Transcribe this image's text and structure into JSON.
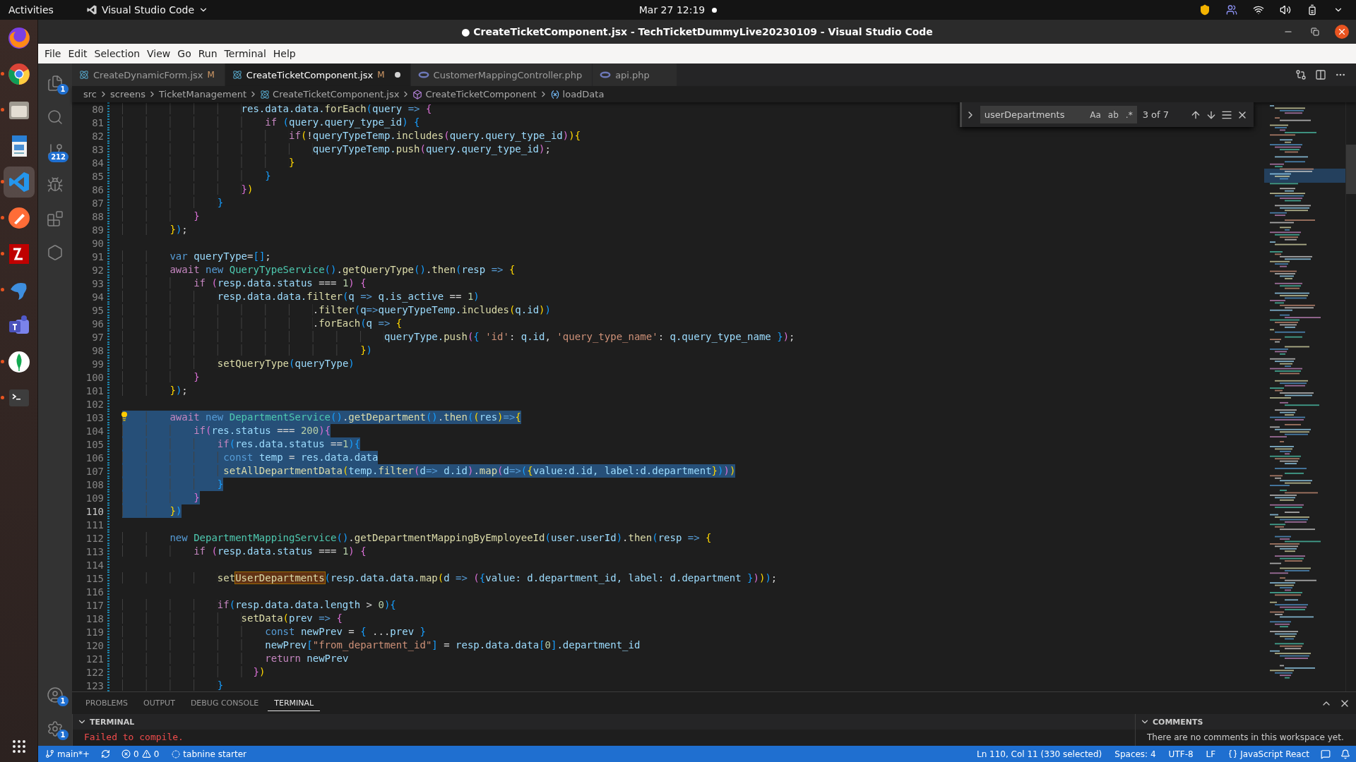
{
  "topbar": {
    "activities": "Activities",
    "app": "Visual Studio Code",
    "clock": "Mar 27  12:19"
  },
  "dock": [
    {
      "kind": "firefox",
      "running": false,
      "selected": false
    },
    {
      "kind": "chrome",
      "running": true,
      "selected": false
    },
    {
      "kind": "files",
      "running": true,
      "selected": false
    },
    {
      "kind": "writer",
      "running": false,
      "selected": false
    },
    {
      "kind": "vscode",
      "running": true,
      "selected": true
    },
    {
      "kind": "postman",
      "running": true,
      "selected": false
    },
    {
      "kind": "filezilla",
      "running": true,
      "selected": false
    },
    {
      "kind": "dolphin",
      "running": true,
      "selected": false
    },
    {
      "kind": "teams",
      "running": false,
      "selected": false
    },
    {
      "kind": "mongodb",
      "running": true,
      "selected": false
    },
    {
      "kind": "terminal",
      "running": true,
      "selected": false
    }
  ],
  "window": {
    "title": "● CreateTicketComponent.jsx - TechTicketDummyLive20230109 - Visual Studio Code"
  },
  "menu": [
    "File",
    "Edit",
    "Selection",
    "View",
    "Go",
    "Run",
    "Terminal",
    "Help"
  ],
  "activity_bar": [
    {
      "kind": "explorer",
      "badge": "1"
    },
    {
      "kind": "search"
    },
    {
      "kind": "scm",
      "badge": "212"
    },
    {
      "kind": "debug"
    },
    {
      "kind": "extensions"
    },
    {
      "kind": "remote"
    }
  ],
  "activity_bar_bottom": [
    {
      "kind": "accounts",
      "badge": "1"
    },
    {
      "kind": "settings",
      "badge": "1"
    }
  ],
  "tabs": [
    {
      "label": "CreateDynamicForm.jsx",
      "kind": "react",
      "status": "M",
      "dirty": false,
      "selected": false
    },
    {
      "label": "CreateTicketComponent.jsx",
      "kind": "react",
      "status": "M",
      "dirty": true,
      "selected": true
    },
    {
      "label": "CustomerMappingController.php",
      "kind": "php",
      "dirty": false,
      "selected": false
    },
    {
      "label": "api.php",
      "kind": "php",
      "dirty": false,
      "selected": false
    }
  ],
  "breadcrumbs": [
    {
      "label": "src",
      "kind": "folder"
    },
    {
      "label": "screens",
      "kind": "folder"
    },
    {
      "label": "TicketManagement",
      "kind": "folder"
    },
    {
      "label": "CreateTicketComponent.jsx",
      "kind": "react"
    },
    {
      "label": "CreateTicketComponent",
      "kind": "component"
    },
    {
      "label": "loadData",
      "kind": "variable"
    }
  ],
  "find": {
    "value": "userDepartments",
    "options": [
      "Aa",
      "ab",
      ".*"
    ],
    "count": "3 of 7"
  },
  "code": [
    {
      "n": "80",
      "selected": false,
      "active": false,
      "tokens": [
        {
          "kind": "v",
          "text": "                    res.data.data."
        },
        {
          "kind": "f",
          "text": "forEach"
        },
        {
          "kind": "b3",
          "text": "("
        },
        {
          "kind": "v",
          "text": "query"
        },
        {
          "kind": "k",
          "text": " => "
        },
        {
          "kind": "b2",
          "text": "{"
        }
      ]
    },
    {
      "n": "81",
      "selected": false,
      "active": false,
      "tokens": [
        {
          "kind": "c",
          "text": "                        if "
        },
        {
          "kind": "b3",
          "text": "("
        },
        {
          "kind": "v",
          "text": "query.query_type_id"
        },
        {
          "kind": "b3",
          "text": ") {"
        }
      ]
    },
    {
      "n": "82",
      "selected": false,
      "active": false,
      "tokens": [
        {
          "kind": "c",
          "text": "                            if"
        },
        {
          "kind": "b1",
          "text": "("
        },
        {
          "kind": "p",
          "text": "!"
        },
        {
          "kind": "v",
          "text": "queryTypeTemp."
        },
        {
          "kind": "f",
          "text": "includes"
        },
        {
          "kind": "b2",
          "text": "("
        },
        {
          "kind": "v",
          "text": "query.query_type_id"
        },
        {
          "kind": "b2",
          "text": ")"
        },
        {
          "kind": "b1",
          "text": "){"
        }
      ]
    },
    {
      "n": "83",
      "selected": false,
      "active": false,
      "tokens": [
        {
          "kind": "v",
          "text": "                                queryTypeTemp."
        },
        {
          "kind": "f",
          "text": "push"
        },
        {
          "kind": "b2",
          "text": "("
        },
        {
          "kind": "v",
          "text": "query.query_type_id"
        },
        {
          "kind": "b2",
          "text": ")"
        },
        {
          "kind": "p",
          "text": ";"
        }
      ]
    },
    {
      "n": "84",
      "selected": false,
      "active": false,
      "tokens": [
        {
          "kind": "b1",
          "text": "                            }"
        }
      ]
    },
    {
      "n": "85",
      "selected": false,
      "active": false,
      "tokens": [
        {
          "kind": "b3",
          "text": "                        }"
        }
      ]
    },
    {
      "n": "86",
      "selected": false,
      "active": false,
      "tokens": [
        {
          "kind": "b2",
          "text": "                    }"
        },
        {
          "kind": "b1",
          "text": ")"
        }
      ]
    },
    {
      "n": "87",
      "selected": false,
      "active": false,
      "tokens": [
        {
          "kind": "b3",
          "text": "                }"
        }
      ]
    },
    {
      "n": "88",
      "selected": false,
      "active": false,
      "tokens": [
        {
          "kind": "b2",
          "text": "            }"
        }
      ]
    },
    {
      "n": "89",
      "selected": false,
      "active": false,
      "tokens": [
        {
          "kind": "b1",
          "text": "        }"
        },
        {
          "kind": "b3",
          "text": ")"
        },
        {
          "kind": "p",
          "text": ";"
        }
      ]
    },
    {
      "n": "90",
      "selected": false,
      "active": false
    },
    {
      "n": "91",
      "selected": false,
      "active": false,
      "tokens": [
        {
          "kind": "k",
          "text": "        var "
        },
        {
          "kind": "v",
          "text": "queryType"
        },
        {
          "kind": "p",
          "text": "="
        },
        {
          "kind": "b3",
          "text": "[]"
        },
        {
          "kind": "p",
          "text": ";"
        }
      ]
    },
    {
      "n": "92",
      "selected": false,
      "active": false,
      "tokens": [
        {
          "kind": "c",
          "text": "        await "
        },
        {
          "kind": "k",
          "text": "new "
        },
        {
          "kind": "t",
          "text": "QueryTypeService"
        },
        {
          "kind": "b3",
          "text": "()"
        },
        {
          "kind": "p",
          "text": "."
        },
        {
          "kind": "f",
          "text": "getQueryType"
        },
        {
          "kind": "b3",
          "text": "()"
        },
        {
          "kind": "p",
          "text": "."
        },
        {
          "kind": "f",
          "text": "then"
        },
        {
          "kind": "b3",
          "text": "("
        },
        {
          "kind": "v",
          "text": "resp"
        },
        {
          "kind": "k",
          "text": " => "
        },
        {
          "kind": "b1",
          "text": "{"
        }
      ]
    },
    {
      "n": "93",
      "selected": false,
      "active": false,
      "tokens": [
        {
          "kind": "c",
          "text": "            if "
        },
        {
          "kind": "b2",
          "text": "("
        },
        {
          "kind": "v",
          "text": "resp.data.status"
        },
        {
          "kind": "p",
          "text": " === "
        },
        {
          "kind": "n",
          "text": "1"
        },
        {
          "kind": "b2",
          "text": ") {"
        }
      ]
    },
    {
      "n": "94",
      "selected": false,
      "active": false,
      "tokens": [
        {
          "kind": "v",
          "text": "                resp.data.data."
        },
        {
          "kind": "f",
          "text": "filter"
        },
        {
          "kind": "b3",
          "text": "("
        },
        {
          "kind": "v",
          "text": "q"
        },
        {
          "kind": "k",
          "text": " => "
        },
        {
          "kind": "v",
          "text": "q.is_active"
        },
        {
          "kind": "p",
          "text": " == "
        },
        {
          "kind": "n",
          "text": "1"
        },
        {
          "kind": "b3",
          "text": ")"
        }
      ]
    },
    {
      "n": "95",
      "selected": false,
      "active": false,
      "tokens": [
        {
          "kind": "p",
          "text": "                                ."
        },
        {
          "kind": "f",
          "text": "filter"
        },
        {
          "kind": "b3",
          "text": "("
        },
        {
          "kind": "v",
          "text": "q"
        },
        {
          "kind": "k",
          "text": "=>"
        },
        {
          "kind": "v",
          "text": "queryTypeTemp."
        },
        {
          "kind": "f",
          "text": "includes"
        },
        {
          "kind": "b1",
          "text": "("
        },
        {
          "kind": "v",
          "text": "q.id"
        },
        {
          "kind": "b1",
          "text": ")"
        },
        {
          "kind": "b3",
          "text": ")"
        }
      ]
    },
    {
      "n": "96",
      "selected": false,
      "active": false,
      "tokens": [
        {
          "kind": "p",
          "text": "                                ."
        },
        {
          "kind": "f",
          "text": "forEach"
        },
        {
          "kind": "b3",
          "text": "("
        },
        {
          "kind": "v",
          "text": "q"
        },
        {
          "kind": "k",
          "text": " => "
        },
        {
          "kind": "b1",
          "text": "{"
        }
      ]
    },
    {
      "n": "97",
      "selected": false,
      "active": false,
      "tokens": [
        {
          "kind": "v",
          "text": "                                            queryType."
        },
        {
          "kind": "f",
          "text": "push"
        },
        {
          "kind": "b2",
          "text": "("
        },
        {
          "kind": "b3",
          "text": "{ "
        },
        {
          "kind": "s",
          "text": "'id'"
        },
        {
          "kind": "p",
          "text": ": "
        },
        {
          "kind": "v",
          "text": "q.id"
        },
        {
          "kind": "p",
          "text": ", "
        },
        {
          "kind": "s",
          "text": "'query_type_name'"
        },
        {
          "kind": "p",
          "text": ": "
        },
        {
          "kind": "v",
          "text": "q.query_type_name "
        },
        {
          "kind": "b3",
          "text": "}"
        },
        {
          "kind": "b2",
          "text": ")"
        },
        {
          "kind": "p",
          "text": ";"
        }
      ]
    },
    {
      "n": "98",
      "selected": false,
      "active": false,
      "tokens": [
        {
          "kind": "b1",
          "text": "                                        }"
        },
        {
          "kind": "b3",
          "text": ")"
        }
      ]
    },
    {
      "n": "99",
      "selected": false,
      "active": false,
      "tokens": [
        {
          "kind": "f",
          "text": "                setQueryType"
        },
        {
          "kind": "b3",
          "text": "("
        },
        {
          "kind": "v",
          "text": "queryType"
        },
        {
          "kind": "b3",
          "text": ")"
        }
      ]
    },
    {
      "n": "100",
      "selected": false,
      "active": false,
      "tokens": [
        {
          "kind": "b2",
          "text": "            }"
        }
      ]
    },
    {
      "n": "101",
      "selected": false,
      "active": false,
      "tokens": [
        {
          "kind": "b1",
          "text": "        }"
        },
        {
          "kind": "b3",
          "text": ")"
        },
        {
          "kind": "p",
          "text": ";"
        }
      ]
    },
    {
      "n": "102",
      "selected": false,
      "active": false
    },
    {
      "n": "103",
      "selected": true,
      "active": false,
      "lightbulb": true,
      "tokens": [
        {
          "kind": "c",
          "text": "        await "
        },
        {
          "kind": "k",
          "text": "new "
        },
        {
          "kind": "t",
          "text": "DepartmentService"
        },
        {
          "kind": "b3",
          "text": "()"
        },
        {
          "kind": "p",
          "text": "."
        },
        {
          "kind": "f",
          "text": "getDepartment"
        },
        {
          "kind": "b3",
          "text": "()"
        },
        {
          "kind": "p",
          "text": "."
        },
        {
          "kind": "f",
          "text": "then"
        },
        {
          "kind": "b3",
          "text": "("
        },
        {
          "kind": "b1",
          "text": "("
        },
        {
          "kind": "v",
          "text": "res"
        },
        {
          "kind": "b1",
          "text": ")"
        },
        {
          "kind": "k",
          "text": "=>"
        },
        {
          "kind": "b1",
          "text": "{"
        }
      ]
    },
    {
      "n": "104",
      "selected": true,
      "active": false,
      "tokens": [
        {
          "kind": "c",
          "text": "            if"
        },
        {
          "kind": "b2",
          "text": "("
        },
        {
          "kind": "v",
          "text": "res.status"
        },
        {
          "kind": "p",
          "text": " === "
        },
        {
          "kind": "n",
          "text": "200"
        },
        {
          "kind": "b2",
          "text": "){"
        }
      ]
    },
    {
      "n": "105",
      "selected": true,
      "active": false,
      "tokens": [
        {
          "kind": "c",
          "text": "                if"
        },
        {
          "kind": "b3",
          "text": "("
        },
        {
          "kind": "v",
          "text": "res.data.status"
        },
        {
          "kind": "p",
          "text": " =="
        },
        {
          "kind": "n",
          "text": "1"
        },
        {
          "kind": "b3",
          "text": "){"
        }
      ]
    },
    {
      "n": "106",
      "selected": true,
      "active": false,
      "tokens": [
        {
          "kind": "k",
          "text": "                 const "
        },
        {
          "kind": "v",
          "text": "temp"
        },
        {
          "kind": "p",
          "text": " = "
        },
        {
          "kind": "v",
          "text": "res.data.data"
        }
      ]
    },
    {
      "n": "107",
      "selected": true,
      "active": false,
      "tokens": [
        {
          "kind": "f",
          "text": "                 setAllDepartmentData"
        },
        {
          "kind": "b1",
          "text": "("
        },
        {
          "kind": "v",
          "text": "temp."
        },
        {
          "kind": "f",
          "text": "filter"
        },
        {
          "kind": "b2",
          "text": "("
        },
        {
          "kind": "v",
          "text": "d"
        },
        {
          "kind": "k",
          "text": "=> "
        },
        {
          "kind": "v",
          "text": "d.id"
        },
        {
          "kind": "b2",
          "text": ")"
        },
        {
          "kind": "p",
          "text": "."
        },
        {
          "kind": "f",
          "text": "map"
        },
        {
          "kind": "b2",
          "text": "("
        },
        {
          "kind": "v",
          "text": "d"
        },
        {
          "kind": "k",
          "text": "=>"
        },
        {
          "kind": "b3",
          "text": "("
        },
        {
          "kind": "b1",
          "text": "{"
        },
        {
          "kind": "v",
          "text": "value:d.id, label:d.department"
        },
        {
          "kind": "b1",
          "text": "}"
        },
        {
          "kind": "b3",
          "text": ")"
        },
        {
          "kind": "b2",
          "text": ")"
        },
        {
          "kind": "b1",
          "text": ")"
        }
      ]
    },
    {
      "n": "108",
      "selected": true,
      "active": false,
      "tokens": [
        {
          "kind": "b3",
          "text": "                }"
        }
      ]
    },
    {
      "n": "109",
      "selected": true,
      "active": false,
      "tokens": [
        {
          "kind": "b2",
          "text": "            }"
        }
      ]
    },
    {
      "n": "110",
      "selected": true,
      "active": true,
      "tokens": [
        {
          "kind": "b1",
          "text": "        }"
        },
        {
          "kind": "b3",
          "text": ")"
        }
      ]
    },
    {
      "n": "111",
      "selected": false,
      "active": false
    },
    {
      "n": "112",
      "selected": false,
      "active": false,
      "tokens": [
        {
          "kind": "k",
          "text": "        new "
        },
        {
          "kind": "t",
          "text": "DepartmentMappingService"
        },
        {
          "kind": "b3",
          "text": "()"
        },
        {
          "kind": "p",
          "text": "."
        },
        {
          "kind": "f",
          "text": "getDepartmentMappingByEmployeeId"
        },
        {
          "kind": "b3",
          "text": "("
        },
        {
          "kind": "v",
          "text": "user.userId"
        },
        {
          "kind": "b3",
          "text": ")"
        },
        {
          "kind": "p",
          "text": "."
        },
        {
          "kind": "f",
          "text": "then"
        },
        {
          "kind": "b3",
          "text": "("
        },
        {
          "kind": "v",
          "text": "resp"
        },
        {
          "kind": "k",
          "text": " => "
        },
        {
          "kind": "b1",
          "text": "{"
        }
      ]
    },
    {
      "n": "113",
      "selected": false,
      "active": false,
      "tokens": [
        {
          "kind": "c",
          "text": "            if "
        },
        {
          "kind": "b2",
          "text": "("
        },
        {
          "kind": "v",
          "text": "resp.data.status"
        },
        {
          "kind": "p",
          "text": " === "
        },
        {
          "kind": "n",
          "text": "1"
        },
        {
          "kind": "b2",
          "text": ") {"
        }
      ]
    },
    {
      "n": "114",
      "selected": false,
      "active": false
    },
    {
      "n": "115",
      "selected": false,
      "active": false,
      "tokens": [
        {
          "kind": "f",
          "text": "                set"
        },
        {
          "kind": "m",
          "text": "UserDepartments"
        },
        {
          "kind": "b3",
          "text": "("
        },
        {
          "kind": "v",
          "text": "resp.data.data."
        },
        {
          "kind": "f",
          "text": "map"
        },
        {
          "kind": "b1",
          "text": "("
        },
        {
          "kind": "v",
          "text": "d"
        },
        {
          "kind": "k",
          "text": " => "
        },
        {
          "kind": "b2",
          "text": "("
        },
        {
          "kind": "b3",
          "text": "{"
        },
        {
          "kind": "v",
          "text": "value: d.department_id, label: d.department "
        },
        {
          "kind": "b3",
          "text": "}"
        },
        {
          "kind": "b2",
          "text": ")"
        },
        {
          "kind": "b1",
          "text": ")"
        },
        {
          "kind": "b3",
          "text": ")"
        },
        {
          "kind": "p",
          "text": ";"
        }
      ]
    },
    {
      "n": "116",
      "selected": false,
      "active": false
    },
    {
      "n": "117",
      "selected": false,
      "active": false,
      "tokens": [
        {
          "kind": "c",
          "text": "                if"
        },
        {
          "kind": "b3",
          "text": "("
        },
        {
          "kind": "v",
          "text": "resp.data.data.length"
        },
        {
          "kind": "p",
          "text": " > "
        },
        {
          "kind": "n",
          "text": "0"
        },
        {
          "kind": "b3",
          "text": "){"
        }
      ]
    },
    {
      "n": "118",
      "selected": false,
      "active": false,
      "tokens": [
        {
          "kind": "f",
          "text": "                    setData"
        },
        {
          "kind": "b1",
          "text": "("
        },
        {
          "kind": "v",
          "text": "prev"
        },
        {
          "kind": "k",
          "text": " => "
        },
        {
          "kind": "b2",
          "text": "{"
        }
      ]
    },
    {
      "n": "119",
      "selected": false,
      "active": false,
      "tokens": [
        {
          "kind": "k",
          "text": "                        const "
        },
        {
          "kind": "v",
          "text": "newPrev"
        },
        {
          "kind": "p",
          "text": " = "
        },
        {
          "kind": "b3",
          "text": "{"
        },
        {
          "kind": "p",
          "text": " ..."
        },
        {
          "kind": "v",
          "text": "prev "
        },
        {
          "kind": "b3",
          "text": "}"
        }
      ]
    },
    {
      "n": "120",
      "selected": false,
      "active": false,
      "tokens": [
        {
          "kind": "v",
          "text": "                        newPrev"
        },
        {
          "kind": "b3",
          "text": "["
        },
        {
          "kind": "s",
          "text": "\"from_department_id\""
        },
        {
          "kind": "b3",
          "text": "]"
        },
        {
          "kind": "p",
          "text": " = "
        },
        {
          "kind": "v",
          "text": "resp.data.data"
        },
        {
          "kind": "b3",
          "text": "["
        },
        {
          "kind": "n",
          "text": "0"
        },
        {
          "kind": "b3",
          "text": "]"
        },
        {
          "kind": "v",
          "text": ".department_id"
        }
      ]
    },
    {
      "n": "121",
      "selected": false,
      "active": false,
      "tokens": [
        {
          "kind": "c",
          "text": "                        return "
        },
        {
          "kind": "v",
          "text": "newPrev"
        }
      ]
    },
    {
      "n": "122",
      "selected": false,
      "active": false,
      "tokens": [
        {
          "kind": "b2",
          "text": "                      }"
        },
        {
          "kind": "b1",
          "text": ")"
        }
      ]
    },
    {
      "n": "123",
      "selected": false,
      "active": false,
      "tokens": [
        {
          "kind": "b3",
          "text": "                }"
        }
      ]
    }
  ],
  "panel": {
    "tabs": [
      {
        "label": "PROBLEMS",
        "selected": false
      },
      {
        "label": "OUTPUT",
        "selected": false
      },
      {
        "label": "DEBUG CONSOLE",
        "selected": false
      },
      {
        "label": "TERMINAL",
        "selected": true
      }
    ],
    "terminal_header": "TERMINAL",
    "terminal_output": "Failed to compile.",
    "comments_header": "COMMENTS",
    "comments_text": "There are no comments in this workspace yet."
  },
  "status_bar": {
    "branch": "main*+",
    "errors": "0",
    "warnings": "0",
    "tabnine": "tabnine starter",
    "position": "Ln 110, Col 11 (330 selected)",
    "indent": "Spaces: 4",
    "encoding": "UTF-8",
    "eol": "LF",
    "language": "JavaScript React"
  }
}
